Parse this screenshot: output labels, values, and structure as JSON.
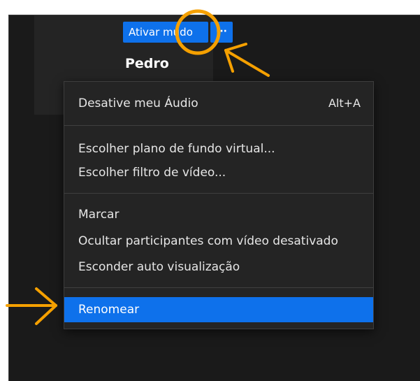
{
  "participant_tile": {
    "mute_button_label": "Ativar mudo",
    "more_button_label": "···",
    "name": "Pedro"
  },
  "context_menu": {
    "items": [
      {
        "label": "Desative meu Áudio",
        "shortcut": "Alt+A"
      },
      {
        "label": "Escolher plano de fundo virtual..."
      },
      {
        "label": "Escolher filtro de vídeo..."
      },
      {
        "label": "Marcar"
      },
      {
        "label": "Ocultar participantes com vídeo desativado"
      },
      {
        "label": "Esconder auto visualização"
      },
      {
        "label": "Renomear",
        "highlighted": true
      }
    ]
  },
  "annotations": {
    "color": "#f5a000",
    "marks": [
      "circle-highlight",
      "arrow-to-more-button",
      "arrow-to-rename"
    ]
  },
  "colors": {
    "accent": "#0e71eb",
    "background": "#1a1a1a",
    "menu_background": "#242424"
  }
}
